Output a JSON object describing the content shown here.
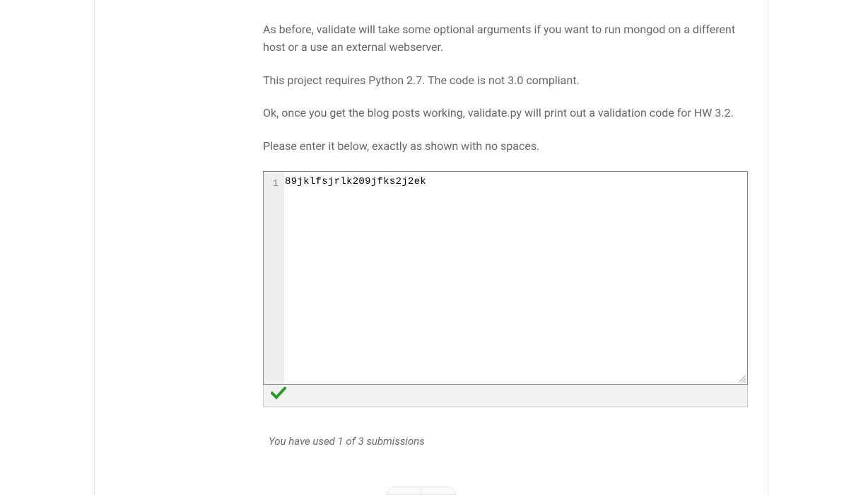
{
  "paragraphs": {
    "p1": "As before, validate will take some optional arguments if you want to run mongod on a different host or a use an external webserver.",
    "p2": "This project requires Python 2.7. The code is not 3.0 compliant.",
    "p3": "Ok, once you get the blog posts working, validate.py will print out a validation code for HW 3.2.",
    "p4": "Please enter it below, exactly as shown with no spaces."
  },
  "editor": {
    "line_number": "1",
    "code_value": "89jklfsjrlk209jfks2j2ek"
  },
  "status": {
    "correct": true
  },
  "submissions_note": "You have used 1 of 3 submissions"
}
